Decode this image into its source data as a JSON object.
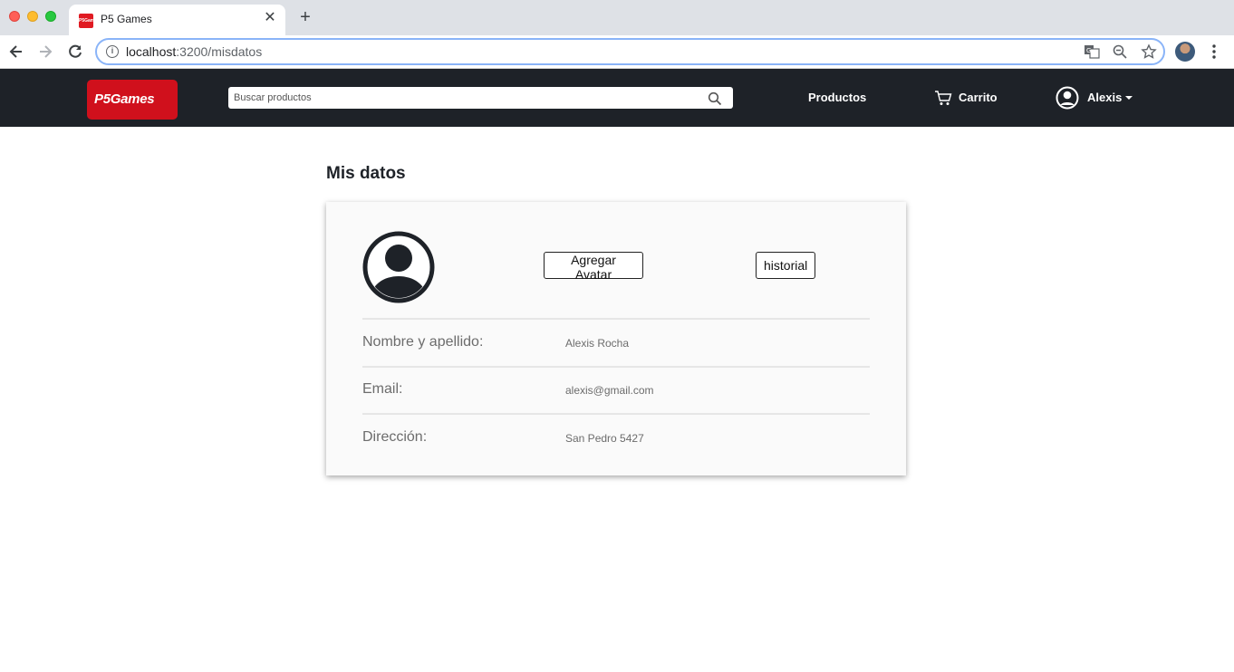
{
  "browser": {
    "tab_title": "P5 Games",
    "tab_favicon_text": "P5Games",
    "url_host": "localhost",
    "url_path": ":3200/misdatos"
  },
  "navbar": {
    "logo_text": "P5Games",
    "search_placeholder": "Buscar productos",
    "products_label": "Productos",
    "cart_label": "Carrito",
    "user_label": "Alexis"
  },
  "page": {
    "title": "Mis datos",
    "add_avatar_label": "Agregar Avatar",
    "history_label": "historial",
    "fields": [
      {
        "label": "Nombre y apellido:",
        "value": "Alexis Rocha"
      },
      {
        "label": "Email:",
        "value": "alexis@gmail.com"
      },
      {
        "label": "Dirección:",
        "value": "San Pedro 5427"
      }
    ]
  },
  "colors": {
    "navbar_bg": "#1e2228",
    "logo_red": "#d0101c",
    "card_bg": "#fafafa"
  }
}
